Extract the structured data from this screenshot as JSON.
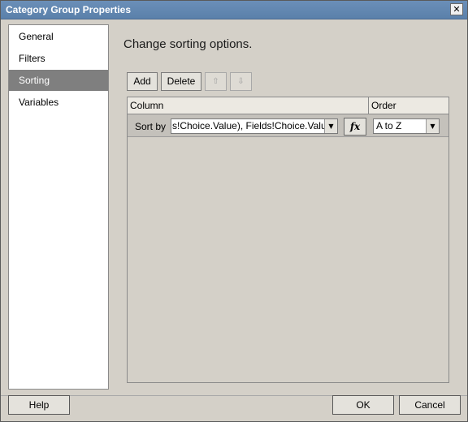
{
  "window": {
    "title": "Category Group Properties",
    "close_glyph": "✕"
  },
  "nav": {
    "items": [
      {
        "label": "General"
      },
      {
        "label": "Filters"
      },
      {
        "label": "Sorting",
        "selected": true
      },
      {
        "label": "Variables"
      }
    ]
  },
  "main": {
    "heading": "Change sorting options.",
    "toolbar": {
      "add_label": "Add",
      "delete_label": "Delete",
      "move_up_glyph": "⇧",
      "move_down_glyph": "⇩"
    },
    "grid": {
      "columns": [
        "Column",
        "Order"
      ],
      "rows": [
        {
          "prefix": "Sort by",
          "expression": "s!Choice.Value), Fields!Choice.Value)",
          "fx_label": "fx",
          "order": "A to Z"
        }
      ]
    }
  },
  "footer": {
    "help_label": "Help",
    "ok_label": "OK",
    "cancel_label": "Cancel"
  },
  "colors": {
    "title_bar": "#5b81ab",
    "selected_nav": "#7f7f7f",
    "dialog_bg": "#d4d0c8"
  }
}
